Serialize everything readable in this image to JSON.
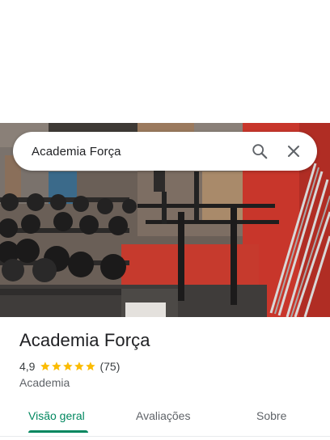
{
  "search": {
    "query": "Academia Força",
    "search_icon": "search-icon",
    "close_icon": "close-icon"
  },
  "place": {
    "name": "Academia Força",
    "rating": "4,9",
    "stars": 5,
    "reviews": "(75)",
    "category": "Academia"
  },
  "tabs": [
    {
      "label": "Visão geral",
      "active": true
    },
    {
      "label": "Avaliações",
      "active": false
    },
    {
      "label": "Sobre",
      "active": false
    }
  ],
  "colors": {
    "accent": "#01875f",
    "star": "#fbbc04",
    "wall_red": "#c8362b"
  }
}
